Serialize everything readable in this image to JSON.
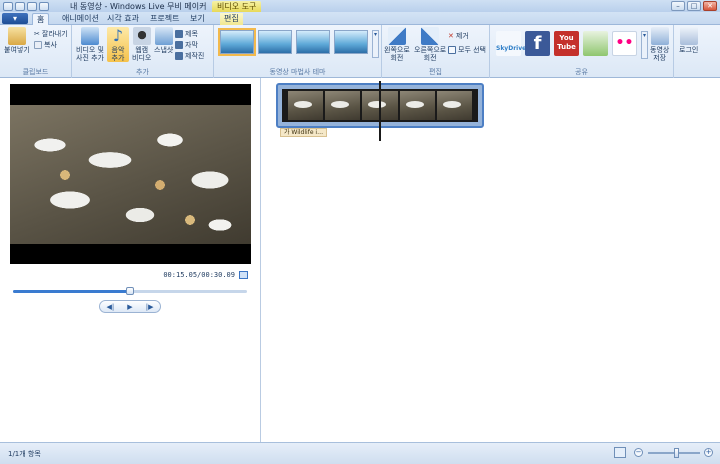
{
  "window": {
    "title": "내 동영상 - Windows Live 무비 메이커",
    "contextual_tab_title": "비디오 도구",
    "controls": {
      "minimize": "–",
      "maximize": "□",
      "close": "✕"
    }
  },
  "tabs": [
    {
      "label": "홈"
    },
    {
      "label": "애니메이션"
    },
    {
      "label": "시각 효과"
    },
    {
      "label": "프로젝트"
    },
    {
      "label": "보기"
    },
    {
      "label": "편집"
    }
  ],
  "ribbon": {
    "clipboard": {
      "group_label": "클립보드",
      "paste": "붙여넣기",
      "cut": "잘라내기",
      "copy": "복사"
    },
    "add": {
      "group_label": "추가",
      "add_videos_photos": "비디오 및\n사진 추가",
      "add_music": "음악\n추가",
      "webcam_video": "웹캠\n비디오",
      "snapshot": "스냅샷",
      "title": "제목",
      "caption": "자막",
      "credits": "제작진"
    },
    "themes": {
      "group_label": "동영상 마법사 테마"
    },
    "editing": {
      "group_label": "편집",
      "rotate_left": "왼쪽으로\n회전",
      "rotate_right": "오른쪽으로\n회전",
      "remove": "제거",
      "select_all": "모두 선택"
    },
    "share": {
      "group_label": "공유",
      "skydrive": "SkyDrive",
      "facebook": "f",
      "youtube": "You\nTube",
      "flickr": "••",
      "save_movie": "동영상\n저장"
    },
    "signin": "로그인"
  },
  "preview": {
    "timecode": "00:15.05/00:30.09",
    "seek_progress": 0.5,
    "transport": {
      "prev": "◀|",
      "play": "▶",
      "next": "|▶"
    }
  },
  "storyboard": {
    "clip_caption": "가 Wildlife i…"
  },
  "status": {
    "item_count": "1/1개 항목",
    "zoom_minus": "−",
    "zoom_plus": "+",
    "zoom_level": 0.55
  },
  "colors": {
    "accent": "#3a7bd0",
    "contextual_tab": "#e7d958"
  }
}
